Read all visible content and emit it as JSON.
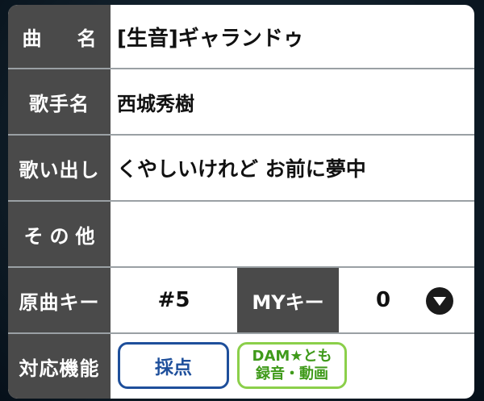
{
  "song": {
    "title_label": "曲　名",
    "title_value": "[生音]ギャランドゥ",
    "artist_label": "歌手名",
    "artist_value": "西城秀樹",
    "lyric_label": "歌い出し",
    "lyric_value": "くやしいけれど お前に夢中",
    "other_label": "その他",
    "other_value": ""
  },
  "key": {
    "original_label": "原曲キー",
    "original_value": "#5",
    "my_label": "MYキー",
    "my_value": "0",
    "dropdown_icon": "chevron-down-circle-icon"
  },
  "features": {
    "label": "対応機能",
    "score_button": "採点",
    "dam_line1": "DAM★とも",
    "dam_line2": "録音・動画"
  },
  "colors": {
    "label_bg": "#4a4a4a",
    "score_blue": "#1e4f9b",
    "dam_green": "#8bcf4a"
  }
}
